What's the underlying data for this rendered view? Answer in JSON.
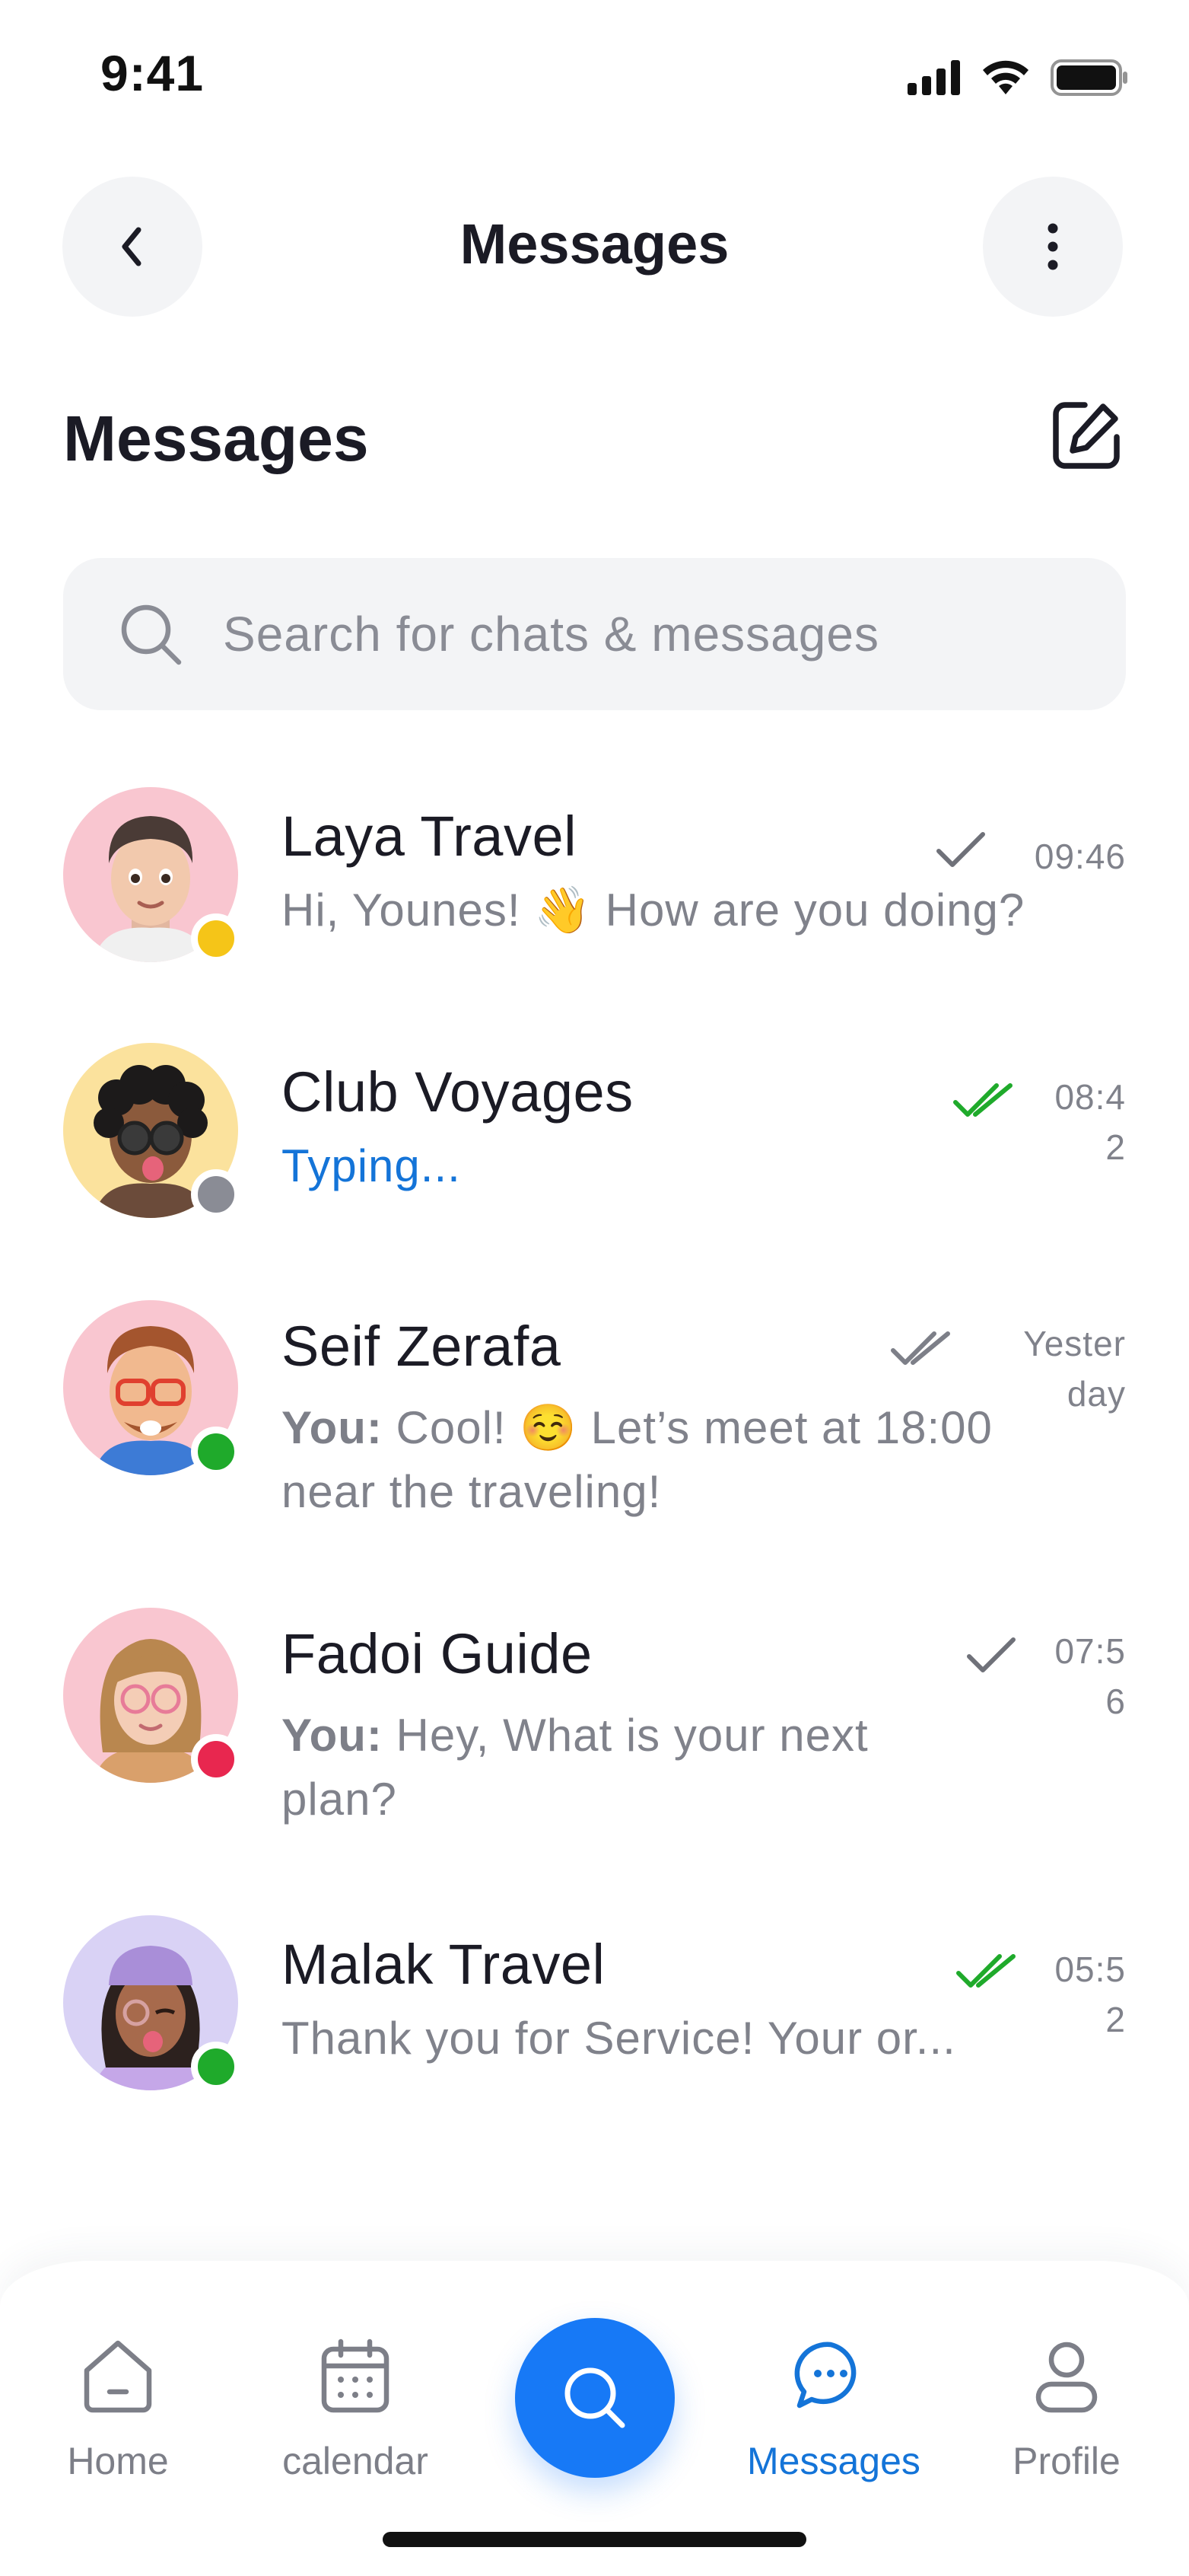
{
  "status_bar": {
    "time": "9:41"
  },
  "nav": {
    "title": "Messages"
  },
  "section": {
    "title": "Messages"
  },
  "search": {
    "placeholder": "Search for chats & messages"
  },
  "chats": [
    {
      "name": "Laya Travel",
      "preview": "Hi, Younes! 👋 How are you doing?",
      "time": "09:46",
      "status": "read-single",
      "presence_color": "#f5c518",
      "avatar_bg": "#f9c6d0"
    },
    {
      "name": "Club Voyages",
      "preview": "Typing...",
      "time_line1": "08:4",
      "time_line2": "2",
      "status": "read-double-green",
      "presence_color": "#8a8c95",
      "avatar_bg": "#fbe29d"
    },
    {
      "name": "Seif Zerafa",
      "preview_prefix": "You:",
      "preview_line1": " Cool! ☺️ Let’s meet at 18:00",
      "preview_line2": "near the traveling!",
      "time_line1": "Yester",
      "time_line2": "day",
      "status": "double-gray",
      "presence_color": "#1faa2b",
      "avatar_bg": "#f9c6d0"
    },
    {
      "name": "Fadoi Guide",
      "preview_prefix": "You:",
      "preview_line1": " Hey, What is your next",
      "preview_line2": "plan?",
      "time_line1": "07:5",
      "time_line2": "6",
      "status": "read-single",
      "presence_color": "#e8274f",
      "avatar_bg": "#f9c6d0"
    },
    {
      "name": "Malak Travel",
      "preview": "Thank you for Service! Your or...",
      "time_line1": "05:5",
      "time_line2": "2",
      "status": "read-double-green",
      "presence_color": "#1faa2b",
      "avatar_bg": "#d9d2f5"
    }
  ],
  "tabs": [
    {
      "label": "Home",
      "icon": "home-icon"
    },
    {
      "label": "calendar",
      "icon": "calendar-icon"
    },
    {
      "label": "Messages",
      "icon": "chat-bubble-icon",
      "active": true
    },
    {
      "label": "Profile",
      "icon": "user-icon"
    }
  ],
  "colors": {
    "accent": "#1779f6",
    "text_primary": "#1b1b25",
    "text_secondary": "#80828b",
    "green_tick": "#1faa2b"
  }
}
